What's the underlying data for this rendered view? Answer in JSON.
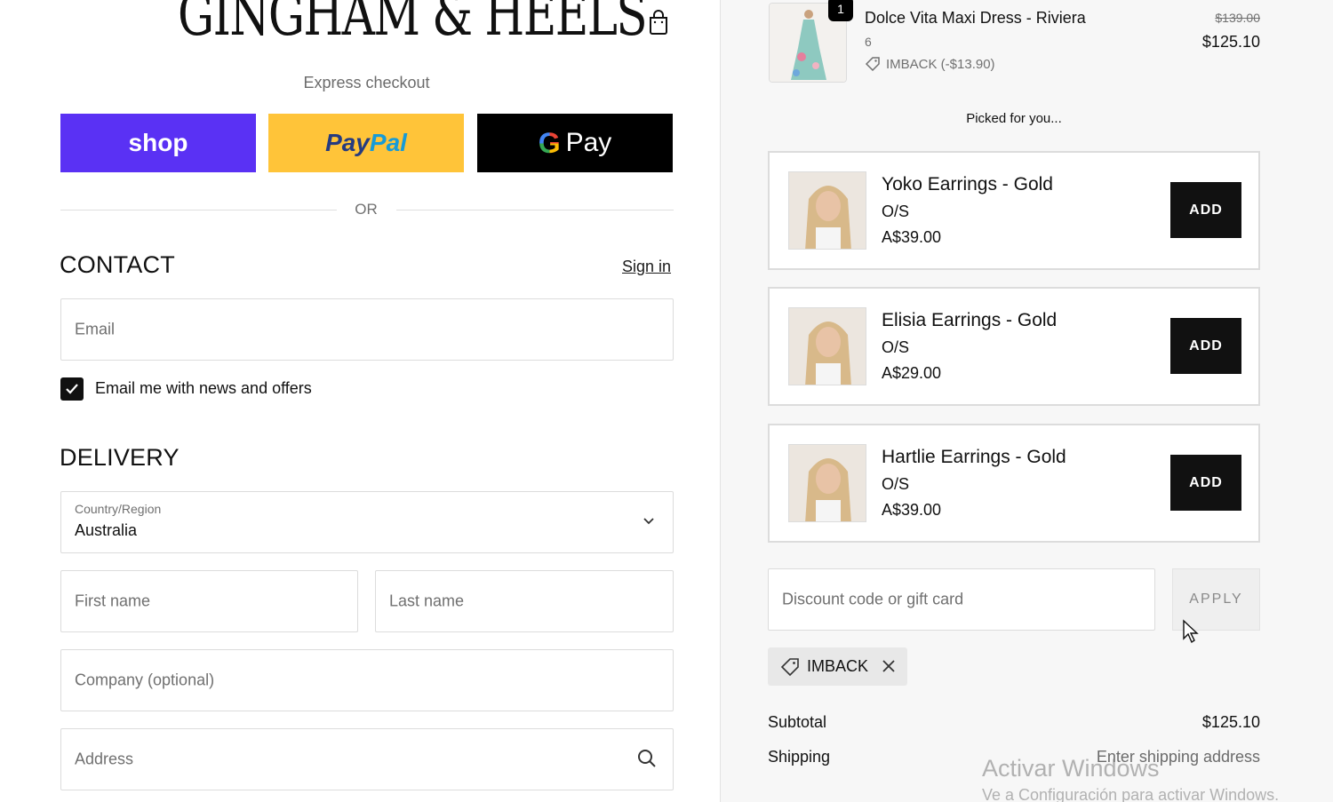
{
  "header": {
    "logo_text": "GINGHAM & HEELS",
    "bag_icon": "shopping-bag-icon"
  },
  "express": {
    "label": "Express checkout",
    "shop_label": "shop",
    "paypal_label_a": "Pay",
    "paypal_label_b": "Pal",
    "gpay_g": "G",
    "gpay_label": "Pay",
    "or_label": "OR"
  },
  "contact": {
    "title": "CONTACT",
    "sign_in": "Sign in",
    "email_placeholder": "Email",
    "newsletter_label": "Email me with news and offers",
    "newsletter_checked": true
  },
  "delivery": {
    "title": "DELIVERY",
    "country_label": "Country/Region",
    "country_value": "Australia",
    "first_name_placeholder": "First name",
    "last_name_placeholder": "Last name",
    "company_placeholder": "Company (optional)",
    "address_placeholder": "Address"
  },
  "order": {
    "item": {
      "name": "Dolce Vita Maxi Dress - Riviera",
      "variant": "6",
      "quantity": "1",
      "discount": "IMBACK (-$13.90)",
      "original_price": "$139.00",
      "price": "$125.10"
    },
    "picked_label": "Picked for you...",
    "upsells": [
      {
        "name": "Yoko Earrings - Gold",
        "size": "O/S",
        "price": "A$39.00",
        "button": "ADD"
      },
      {
        "name": "Elisia Earrings - Gold",
        "size": "O/S",
        "price": "A$29.00",
        "button": "ADD"
      },
      {
        "name": "Hartlie Earrings - Gold",
        "size": "O/S",
        "price": "A$39.00",
        "button": "ADD"
      }
    ],
    "discount_placeholder": "Discount code or gift card",
    "apply_label": "APPLY",
    "applied_code": "IMBACK",
    "subtotal_label": "Subtotal",
    "subtotal_value": "$125.10",
    "shipping_label": "Shipping",
    "shipping_value": "Enter shipping address"
  },
  "overlay": {
    "watermark_title": "Activar Windows",
    "watermark_sub": "Ve a Configuración para activar Windows."
  },
  "colors": {
    "shop": "#5a31f4",
    "paypal": "#ffc439",
    "gpay": "#000000",
    "add_button": "#111111"
  }
}
